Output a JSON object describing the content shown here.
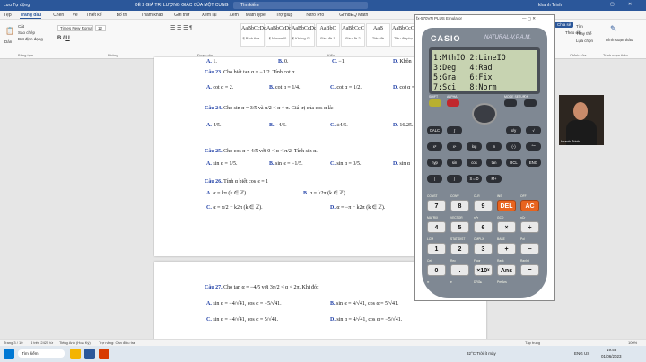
{
  "titlebar": {
    "autosave": "Lưu Tự động",
    "doc_title": "ĐÈ 2 GIÁ TRỊ LƯỢNG GIÁC CỦA MỘT CUNG",
    "search": "Tìm kiếm",
    "user": "khanh Trinh"
  },
  "menu": [
    "Tệp",
    "Trang đầu",
    "Chèn",
    "Vẽ",
    "Thiết kế",
    "Bố trí",
    "Tham khảo",
    "Gửi thư",
    "Xem lại",
    "Xem",
    "MathType",
    "Trợ giúp",
    "Nitro Pro",
    "GrindEQ Math"
  ],
  "menu_active": "Trang đầu",
  "ribbon": {
    "paste": "Dán",
    "cut": "Cắt",
    "copy": "Sao chép",
    "format_painter": "Bút định dạng",
    "font_name": "Times New Roma",
    "font_size": "12",
    "styles": [
      {
        "preview": "AaBbCcDc",
        "label": "¶ Bình thư..."
      },
      {
        "preview": "AaBbCcDc",
        "label": "¶ Normal,0"
      },
      {
        "preview": "AaBbCcDc",
        "label": "¶ Không Gi..."
      },
      {
        "preview": "AaBbC",
        "label": "Đầu đề 1"
      },
      {
        "preview": "AaBbCcC",
        "label": "Đầu đề 2"
      },
      {
        "preview": "AaB",
        "label": "Tiêu đề"
      },
      {
        "preview": "AaBbCcC",
        "label": "Tiêu đề phụ"
      }
    ],
    "share": "Chia sẻ",
    "comments": "Chú thích",
    "track": "Theo dõi",
    "find": "Tìm",
    "replace": "Thay thế",
    "select": "Lựa chọn",
    "editor": "Trình soạn thảo",
    "groups": [
      "Bảng tạm",
      "Phông",
      "Đoạn văn",
      "Kiểu",
      "Chỉnh sửa",
      "Trình soạn thảo"
    ]
  },
  "page1": {
    "top_options": [
      {
        "letter": "A.",
        "text": "1."
      },
      {
        "letter": "B.",
        "text": "0."
      },
      {
        "letter": "C.",
        "text": "−1."
      },
      {
        "letter": "D.",
        "text": "Khôn"
      }
    ],
    "questions": [
      {
        "num": "Câu 23.",
        "text": "Cho biết tan α = −1/2. Tính cot α",
        "options": [
          {
            "letter": "A.",
            "text": "cot α = 2."
          },
          {
            "letter": "B.",
            "text": "cot α = 1/4."
          },
          {
            "letter": "C.",
            "text": "cot α = 1/2."
          },
          {
            "letter": "D.",
            "text": "cot α = −2."
          }
        ]
      },
      {
        "num": "Câu 24.",
        "text": "Cho sin α = 3/5 và π/2 < α < π. Giá trị của cos α là:",
        "options": [
          {
            "letter": "A.",
            "text": "4/5."
          },
          {
            "letter": "B.",
            "text": "−4/5."
          },
          {
            "letter": "C.",
            "text": "±4/5."
          },
          {
            "letter": "D.",
            "text": "16/25."
          }
        ]
      },
      {
        "num": "Câu 25.",
        "text": "Cho cos α = 4/5 với 0 < α < π/2. Tính sin α.",
        "options": [
          {
            "letter": "A.",
            "text": "sin α = 1/5."
          },
          {
            "letter": "B.",
            "text": "sin α = −1/5."
          },
          {
            "letter": "C.",
            "text": "sin α = 3/5."
          },
          {
            "letter": "D.",
            "text": "sin α"
          }
        ]
      },
      {
        "num": "Câu 26.",
        "text": "Tính α biết cos α = 1",
        "options": [
          {
            "letter": "A.",
            "text": "α = kπ (k ∈ ℤ)."
          },
          {
            "letter": "B.",
            "text": "α = k2π (k ∈ ℤ)."
          },
          {
            "letter": "C.",
            "text": "α = π/2 + k2π (k ∈ ℤ)."
          },
          {
            "letter": "D.",
            "text": "α = −π + k2π (k ∈ ℤ)."
          }
        ]
      }
    ]
  },
  "page2": {
    "questions": [
      {
        "num": "Câu 27.",
        "text": "Cho tan α = −4/5 với 3π/2 < α < 2π. Khi đó:",
        "options": [
          {
            "letter": "A.",
            "text": "sin α = −4/√41, cos α = −5/√41."
          },
          {
            "letter": "B.",
            "text": "sin α = 4/√41, cos α = 5/√41."
          },
          {
            "letter": "C.",
            "text": "sin α = −4/√41, cos α = 5/√41."
          },
          {
            "letter": "D.",
            "text": "sin α = 4/√41, cos α = −5/√41."
          }
        ]
      }
    ]
  },
  "calculator": {
    "window_title": "fx-570VN PLUS Emulator",
    "brand": "CASIO",
    "model": "NATURAL-V.P.A.M.",
    "screen_lines": [
      "1:MthIO 2:LineIO",
      "3:Deg   4:Rad",
      "5:Gra   6:Fix",
      "7:Sci   8:Norm"
    ],
    "function_keys": [
      "SHIFT",
      "ALPHA",
      "MODE SETUP",
      "ON"
    ],
    "small_keys": [
      "CALC",
      "∫",
      "x⁻¹",
      "log□",
      "x/y",
      "√",
      "x²",
      "xⁿ",
      "log",
      "ln",
      "(-)",
      "°'\"",
      "hyp",
      "sin",
      "cos",
      "tan",
      "RCL",
      "ENG",
      "(",
      ")",
      "S⇔D",
      "M+"
    ],
    "number_keys": [
      "7",
      "8",
      "9",
      "DEL",
      "AC",
      "4",
      "5",
      "6",
      "×",
      "÷",
      "1",
      "2",
      "3",
      "+",
      "−",
      "0",
      ".",
      "×10ˣ",
      "Ans",
      "="
    ],
    "key_labels": [
      "CONST",
      "CONV",
      "CLR",
      "INS",
      "OFF",
      "MATRIX",
      "VECTOR",
      "nPr",
      "GCD",
      "nCr",
      "LCM",
      "STAT/DIST",
      "CMPLX",
      "BASE",
      "Pol",
      "Ceil",
      "Rec",
      "Floor",
      "Rank",
      "RanInt",
      "π",
      "e",
      "DRG▸",
      "PreAns"
    ]
  },
  "webcam": {
    "name": "khanh Trinh"
  },
  "status": {
    "page": "Trang 3 / 10",
    "words": "4 trên 2425 từ",
    "lang": "Tiếng Anh (Hoa Kỳ)",
    "mode": "Trợ năng: Cần điều tra",
    "focus": "Tập trung",
    "zoom": "100%"
  },
  "taskbar": {
    "search": "Tìm kiếm",
    "weather": "32°C Trời ít mây",
    "lang": "ENG US",
    "time": "19:53",
    "date": "01/06/2023"
  },
  "colors": {
    "accent": "#2b579a",
    "question": "#1f3fa6",
    "calc_orange": "#e8641f",
    "lcd": "#c7d3b1"
  }
}
